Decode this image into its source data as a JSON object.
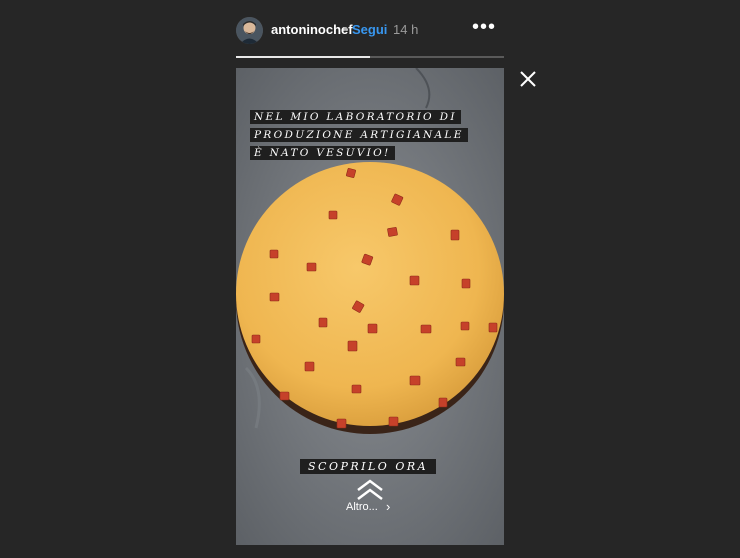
{
  "header": {
    "username": "antoninochef",
    "separator": "•",
    "follow_label": "Segui",
    "time": "14 h",
    "more_glyph": "•••",
    "avatar_icon": "user-avatar"
  },
  "progress": {
    "fraction": 0.5
  },
  "story": {
    "caption_lines": [
      "NEL MIO LABORATORIO DI",
      "PRODUZIONE ARTIGIANALE",
      "È NATO VESUVIO!"
    ],
    "cta_label": "SCOPRILO ORA",
    "swipe_icon": "double-chevron-up-icon",
    "more_label": "Altro...",
    "more_chevron": "›"
  },
  "colors": {
    "background": "#262626",
    "follow": "#3897f0",
    "cake": "#f0b858",
    "fruit": "#c0392b"
  }
}
